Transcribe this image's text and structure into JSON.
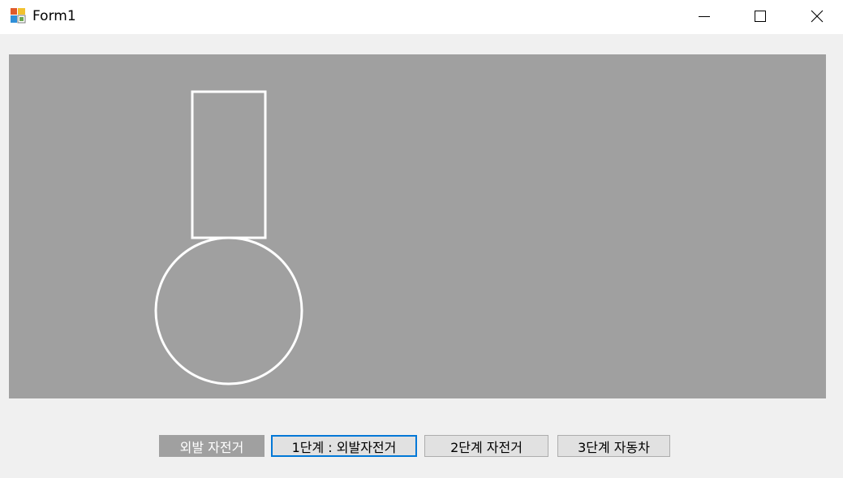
{
  "window": {
    "title": "Form1",
    "icons": {
      "app": "winforms-app-icon",
      "minimize": "minimize-icon",
      "maximize": "maximize-icon",
      "close": "close-icon"
    }
  },
  "canvas": {
    "background": "#a0a0a0",
    "stroke": "#ffffff",
    "shapes": [
      "rectangle",
      "circle"
    ]
  },
  "buttons": {
    "outer": "외발 자전거",
    "step1": "1단계 : 외발자전거",
    "step2": "2단계 자전거",
    "step3": "3단계 자동차"
  },
  "colors": {
    "focus": "#0078d7",
    "button_face": "#e1e1e1",
    "form_bg": "#f0f0f0"
  }
}
